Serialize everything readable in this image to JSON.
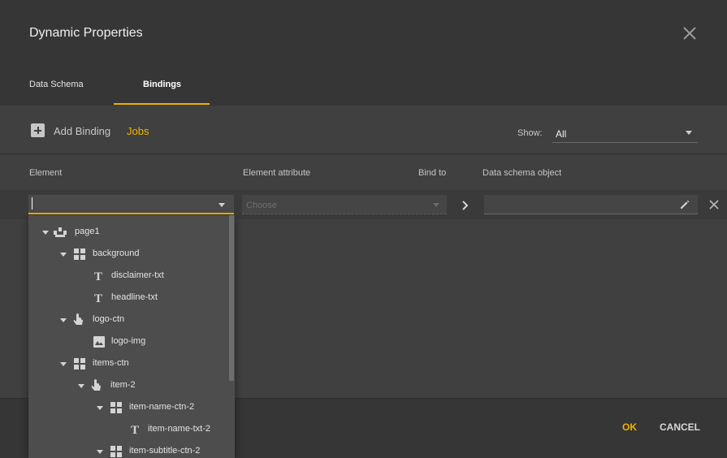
{
  "dialog": {
    "title": "Dynamic Properties",
    "tabs": [
      {
        "label": "Data Schema",
        "active": false
      },
      {
        "label": "Bindings",
        "active": true
      }
    ],
    "accent_color": "#f0b400"
  },
  "toolbar": {
    "add_binding_label": "Add Binding",
    "jobs_label": "Jobs",
    "show_label": "Show:",
    "show_value": "All"
  },
  "columns": {
    "element": "Element",
    "attribute": "Element attribute",
    "bind_to": "Bind to",
    "schema_object": "Data schema object"
  },
  "binding_row": {
    "element_value": "",
    "attribute_placeholder": "Choose",
    "schema_value": ""
  },
  "element_tree": [
    {
      "label": "page1",
      "icon": "page-icon",
      "expanded": true,
      "depth": 0
    },
    {
      "label": "background",
      "icon": "container-grid-icon",
      "expanded": true,
      "depth": 1
    },
    {
      "label": "disclaimer-txt",
      "icon": "text-icon",
      "expanded": null,
      "depth": 2
    },
    {
      "label": "headline-txt",
      "icon": "text-icon",
      "expanded": null,
      "depth": 2
    },
    {
      "label": "logo-ctn",
      "icon": "clickable-container-icon",
      "expanded": true,
      "depth": 1
    },
    {
      "label": "logo-img",
      "icon": "image-icon",
      "expanded": null,
      "depth": 2
    },
    {
      "label": "items-ctn",
      "icon": "container-grid-icon",
      "expanded": true,
      "depth": 1
    },
    {
      "label": "item-2",
      "icon": "clickable-container-icon",
      "expanded": true,
      "depth": 2
    },
    {
      "label": "item-name-ctn-2",
      "icon": "container-grid-icon",
      "expanded": true,
      "depth": 3
    },
    {
      "label": "item-name-txt-2",
      "icon": "text-icon",
      "expanded": null,
      "depth": 4
    },
    {
      "label": "item-subtitle-ctn-2",
      "icon": "container-grid-icon",
      "expanded": true,
      "depth": 3
    }
  ],
  "footer": {
    "ok_label": "OK",
    "cancel_label": "CANCEL"
  }
}
